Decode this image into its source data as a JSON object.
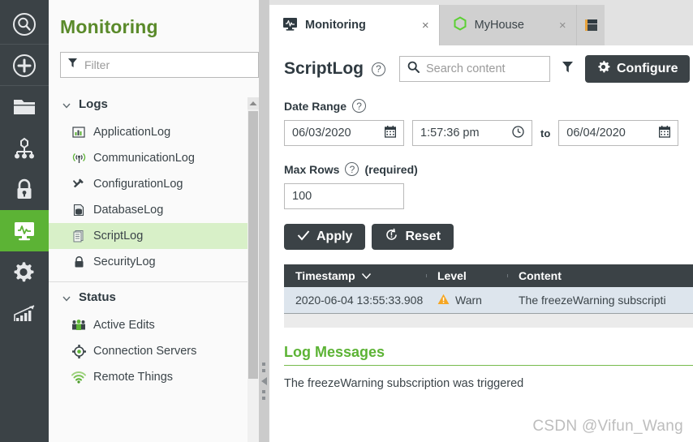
{
  "rail": {
    "items": [
      {
        "name": "search-icon",
        "label": "Search",
        "active": false
      },
      {
        "name": "add-icon",
        "label": "New",
        "active": false
      },
      {
        "name": "folder-icon",
        "label": "Browse",
        "active": false
      },
      {
        "name": "hierarchy-icon",
        "label": "Model",
        "active": false
      },
      {
        "name": "lock-icon",
        "label": "Security",
        "active": false
      },
      {
        "name": "monitor-icon",
        "label": "Monitoring",
        "active": true
      },
      {
        "name": "gear-icon",
        "label": "Configuration",
        "active": false
      },
      {
        "name": "chart-icon",
        "label": "Analytics",
        "active": false
      }
    ],
    "accent": "#5cb335",
    "background": "#3b4246"
  },
  "sidebar": {
    "title": "Monitoring",
    "title_color": "#5a8a2a",
    "filter": {
      "placeholder": "Filter",
      "value": ""
    },
    "groups": [
      {
        "label": "Logs",
        "expanded": true,
        "items": [
          {
            "label": "ApplicationLog",
            "icon": "bar-chart-icon",
            "selected": false
          },
          {
            "label": "CommunicationLog",
            "icon": "antenna-icon",
            "selected": false
          },
          {
            "label": "ConfigurationLog",
            "icon": "tools-icon",
            "selected": false
          },
          {
            "label": "DatabaseLog",
            "icon": "database-icon",
            "selected": false
          },
          {
            "label": "ScriptLog",
            "icon": "script-icon",
            "selected": true
          },
          {
            "label": "SecurityLog",
            "icon": "lock-icon",
            "selected": false
          }
        ]
      },
      {
        "label": "Status",
        "expanded": true,
        "items": [
          {
            "label": "Active Edits",
            "icon": "people-icon",
            "selected": false
          },
          {
            "label": "Connection Servers",
            "icon": "connection-icon",
            "selected": false
          },
          {
            "label": "Remote Things",
            "icon": "wifi-icon",
            "selected": false
          }
        ]
      }
    ]
  },
  "tabs": [
    {
      "label": "Monitoring",
      "icon": "monitor-icon",
      "active": true,
      "close": "×"
    },
    {
      "label": "MyHouse",
      "icon": "hexagon-icon",
      "active": false,
      "close": "×"
    }
  ],
  "main": {
    "title": "ScriptLog",
    "help_glyph": "?",
    "search": {
      "placeholder": "Search content",
      "value": ""
    },
    "filter_icon": "funnel-icon",
    "configure_label": "Configure",
    "date_range": {
      "label": "Date Range",
      "from_date": "06/03/2020",
      "from_time": "1:57:36 pm",
      "to_label": "to",
      "to_date": "06/04/2020"
    },
    "max_rows": {
      "label": "Max Rows",
      "required_text": "(required)",
      "value": "100"
    },
    "apply_label": "Apply",
    "reset_label": "Reset",
    "table": {
      "columns": [
        "Timestamp",
        "Level",
        "Content"
      ],
      "sort_column": "Timestamp",
      "sort_direction": "desc",
      "rows": [
        {
          "timestamp": "2020-06-04 13:55:33.908",
          "level": "Warn",
          "level_icon": "warning-icon",
          "level_color": "#f5a623",
          "content": "The freezeWarning subscripti"
        }
      ]
    },
    "log_messages": {
      "title": "Log Messages",
      "title_color": "#5cb335",
      "body": "The freezeWarning subscription was triggered"
    }
  },
  "watermark": "CSDN @Vifun_Wang"
}
